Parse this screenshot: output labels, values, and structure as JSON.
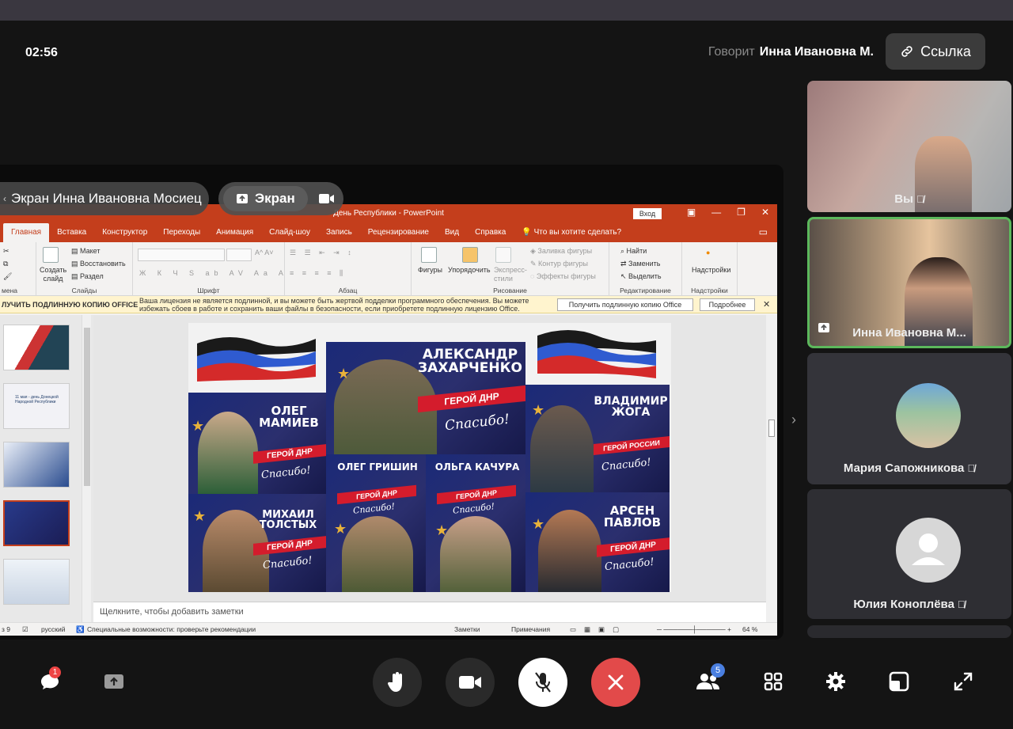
{
  "call": {
    "timer": "02:56",
    "speaking_label": "Говорит",
    "speaking_name": "Инна Ивановна М.",
    "link_button": "Ссылка"
  },
  "share": {
    "owner_label": "Экран Инна Ивановна Мосиец",
    "screen_label": "Экран"
  },
  "ppt": {
    "doc_title": "День Республики  -  PowerPoint",
    "login": "Вход",
    "tabs": [
      "Главная",
      "Вставка",
      "Конструктор",
      "Переходы",
      "Анимация",
      "Слайд-шоу",
      "Запись",
      "Рецензирование",
      "Вид",
      "Справка",
      "Что вы хотите сделать?"
    ],
    "ribbon": {
      "create_slide": "Создать слайд",
      "layout": "Макет",
      "restore": "Восстановить",
      "section": "Раздел",
      "slides_group": "Слайды",
      "clipboard_group": "мена",
      "font_group": "Шрифт",
      "paragraph_group": "Абзац",
      "shapes": "Фигуры",
      "arrange": "Упорядочить",
      "express_styles": "Экспресс-стили",
      "fill": "Заливка фигуры",
      "outline": "Контур фигуры",
      "effects": "Эффекты фигуры",
      "drawing_group": "Рисование",
      "find": "Найти",
      "replace": "Заменить",
      "select": "Выделить",
      "editing_group": "Редактирование",
      "addins": "Надстройки",
      "addins_group": "Надстройки"
    },
    "infobar": {
      "heading": "ЛУЧИТЬ ПОДЛИННУЮ КОПИЮ OFFICE",
      "message": "Ваша лицензия не является подлинной, и вы можете быть жертвой подделки программного обеспечения. Вы можете избежать сбоев в работе и сохранить ваши файлы в безопасности, если приобретете подлинную лицензию Office.",
      "get_button": "Получить подлинную копию Office",
      "more_button": "Подробнее"
    },
    "thumb_texts": [
      "11 мая - день Донецкой Народной Республики"
    ],
    "notes_placeholder": "Щелкните, чтобы добавить заметки",
    "status": {
      "slide": "з 9",
      "language": "русский",
      "accessibility": "Специальные возможности: проверьте рекомендации",
      "notes": "Заметки",
      "comments": "Примечания",
      "zoom": "64 %"
    },
    "slide": {
      "heroes": [
        {
          "name": "АЛЕКСАНДР ЗАХАРЧЕНКО",
          "title": "ГЕРОЙ ДНР",
          "thanks": "Спасибо!"
        },
        {
          "name": "ОЛЕГ МАМИЕВ",
          "title": "ГЕРОЙ ДНР",
          "thanks": "Спасибо!"
        },
        {
          "name": "ВЛАДИМИР ЖОГА",
          "title": "ГЕРОЙ РОССИИ",
          "thanks": "Спасибо!"
        },
        {
          "name": "ОЛЕГ ГРИШИН",
          "title": "ГЕРОЙ ДНР",
          "thanks": "Спасибо!"
        },
        {
          "name": "ОЛЬГА КАЧУРА",
          "title": "ГЕРОЙ ДНР",
          "thanks": "Спасибо!"
        },
        {
          "name": "МИХАИЛ ТОЛСТЫХ",
          "title": "ГЕРОЙ ДНР",
          "thanks": "Спасибо!"
        },
        {
          "name": "АРСЕН ПАВЛОВ",
          "title": "ГЕРОЙ ДНР",
          "thanks": "Спасибо!"
        }
      ]
    }
  },
  "participants": [
    {
      "name": "Вы",
      "muted": true
    },
    {
      "name": "Инна Ивановна М...",
      "muted": false
    },
    {
      "name": "Мария Сапожникова",
      "muted": true
    },
    {
      "name": "Юлия Коноплёва",
      "muted": true
    }
  ],
  "controls": {
    "chat_badge": "1",
    "participants_badge": "5"
  },
  "colors": {
    "end_call": "#e24a4a",
    "active_speaker": "#5cb85c",
    "ppt_accent": "#c43e1c"
  }
}
